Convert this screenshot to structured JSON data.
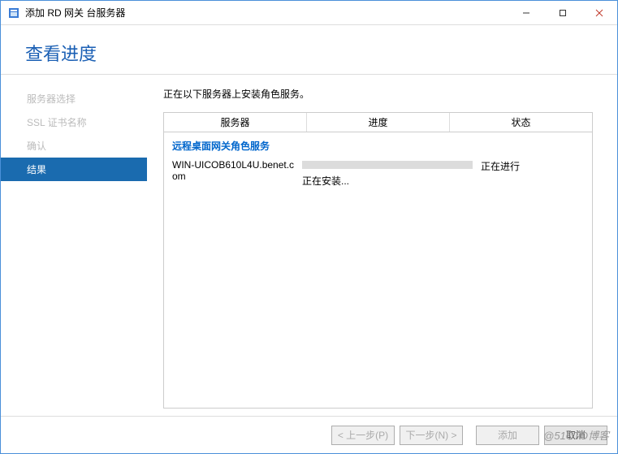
{
  "window": {
    "title": "添加 RD 网关 台服务器"
  },
  "header": {
    "title": "查看进度"
  },
  "sidebar": {
    "items": [
      {
        "label": "服务器选择"
      },
      {
        "label": "SSL 证书名称"
      },
      {
        "label": "确认"
      },
      {
        "label": "结果"
      }
    ]
  },
  "content": {
    "description": "正在以下服务器上安装角色服务。",
    "columns": {
      "server": "服务器",
      "progress": "进度",
      "status": "状态"
    },
    "group_title": "远程桌面网关角色服务",
    "rows": [
      {
        "server": "WIN-UICOB610L4U.benet.com",
        "progress_text": "正在安装...",
        "status": "正在进行"
      }
    ]
  },
  "footer": {
    "prev": "< 上一步(P)",
    "next": "下一步(N) >",
    "add": "添加",
    "cancel": "取消"
  },
  "watermark": "@51CTO博客"
}
